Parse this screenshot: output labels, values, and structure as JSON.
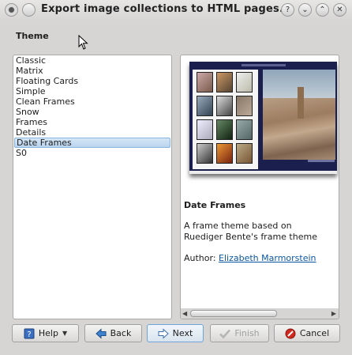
{
  "window": {
    "title": "Export image collections to HTML pages...",
    "help_glyph": "?",
    "min_glyph": "⌄",
    "max_glyph": "⌃",
    "close_glyph": "✕"
  },
  "section_title": "Theme",
  "themes": [
    "Classic",
    "Matrix",
    "Floating Cards",
    "Simple",
    "Clean Frames",
    "Snow",
    "Frames",
    "Details",
    "Date Frames",
    "S0"
  ],
  "selected_theme": "Date Frames",
  "preview": {
    "title": "Date Frames",
    "description": "A frame theme based on Ruediger Bente's frame theme",
    "author_label": "Author:",
    "author_name": "Elizabeth Marmorstein"
  },
  "buttons": {
    "help": "Help",
    "back": "Back",
    "next": "Next",
    "finish": "Finish",
    "cancel": "Cancel"
  },
  "icons": {
    "help": "help-book-icon",
    "back": "arrow-left-icon",
    "next": "arrow-right-icon",
    "finish": "checkmark-icon",
    "cancel": "cancel-icon"
  },
  "colors": {
    "selection": "#c6ddf2",
    "link": "#0b57a4",
    "preview_frame": "#1b1f4d"
  }
}
